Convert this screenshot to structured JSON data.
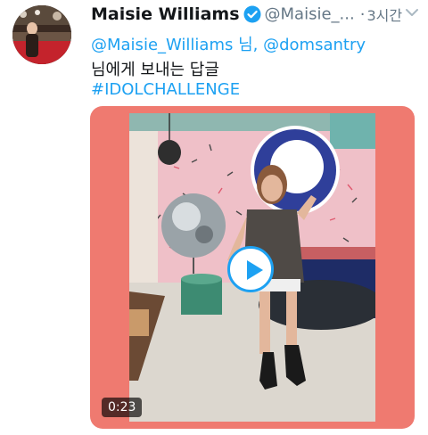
{
  "tweet": {
    "author_name": "Maisie Williams",
    "author_handle": "@Maisie_...",
    "separator": "·",
    "timestamp": "3시간",
    "reply_line": {
      "mention1": "@Maisie_Williams",
      "joiner": " 님, ",
      "mention2": "@domsantry"
    },
    "reply_suffix": "님에게 보내는 답글",
    "hashtag": "#IDOLCHALLENGE",
    "video_duration": "0:23"
  },
  "icons": {
    "verified": "verified-badge-icon",
    "more": "chevron-down-icon",
    "play": "play-icon"
  },
  "colors": {
    "link": "#1da1f2",
    "media_frame": "#ef7a70",
    "text": "#14171a",
    "muted": "#657786"
  }
}
